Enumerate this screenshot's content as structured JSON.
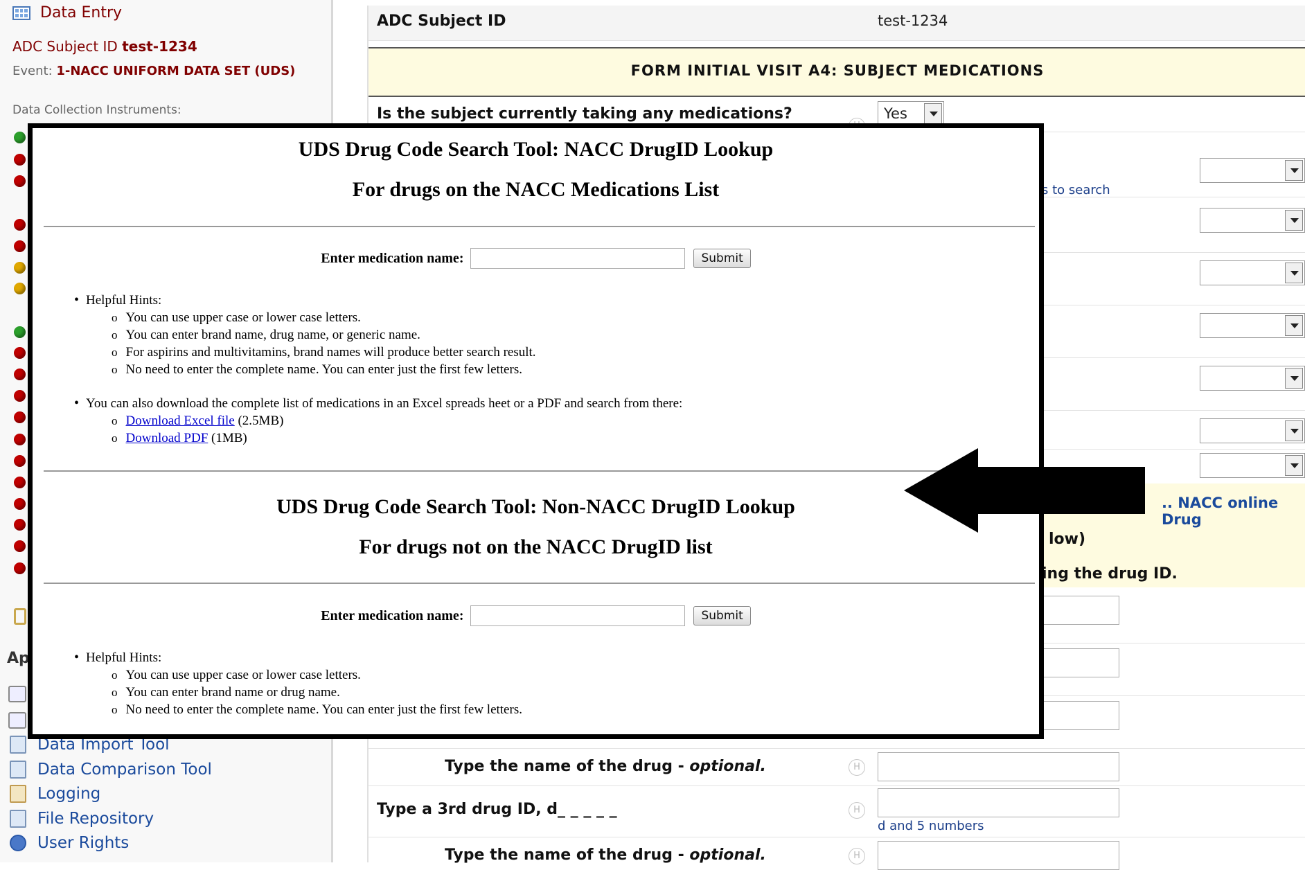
{
  "sidebar": {
    "menu_title": "Data Entry",
    "subject_label": "ADC Subject ID",
    "subject_id": "test-1234",
    "event_label": "Event:",
    "event_value": "1-NACC UNIFORM DATA SET (UDS)",
    "instruments_label": "Data Collection Instruments:",
    "status_dots": [
      "green",
      "red",
      "red",
      "red",
      "red",
      "yellow",
      "yellow",
      "green",
      "red",
      "red",
      "red",
      "red",
      "red",
      "red",
      "red",
      "red",
      "red",
      "red",
      "red"
    ],
    "apps_fragment": "Ap",
    "tools": [
      {
        "label": "Data Import Tool",
        "icon": "import-icon"
      },
      {
        "label": "Data Comparison Tool",
        "icon": "compare-icon"
      },
      {
        "label": "Logging",
        "icon": "logging-icon"
      },
      {
        "label": "File Repository",
        "icon": "file-repository-icon"
      },
      {
        "label": "User Rights",
        "icon": "user-rights-icon"
      }
    ]
  },
  "form": {
    "subject_label": "ADC Subject ID",
    "subject_value": "test-1234",
    "title": "FORM INITIAL VISIT A4: SUBJECT MEDICATIONS",
    "q_meds_label": "Is the subject currently taking any medications?",
    "q_meds_value": "Yes",
    "h_label": "H",
    "search_note_fragment": "s to search",
    "nacc_link_fragment": ".. NACC online Drug",
    "band_line2_fragment": "low)",
    "band_line3_fragment": "ing the drug ID.",
    "drug_name_label": "Type the name of the drug - ",
    "optional": "optional.",
    "third_drug_label": "Type a 3rd drug ID, d_ _ _ _ _",
    "third_drug_note": "d and 5 numbers"
  },
  "popup": {
    "nacc_title": "UDS Drug Code Search Tool: NACC DrugID Lookup",
    "nacc_subtitle": "For drugs on the NACC Medications List",
    "enter_label": "Enter medication name:",
    "submit_label": "Submit",
    "hints_label": "Helpful Hints:",
    "nacc_hints": [
      "You can use upper case or lower case letters.",
      "You can enter brand name, drug name, or generic name.",
      "For aspirins and multivitamins, brand names will produce better search result.",
      "No need to enter the complete name. You can enter just the first few letters."
    ],
    "download_text": "You can also download the complete list of medications in an Excel spreads heet or a PDF and search from there:",
    "download_excel": "Download Excel file",
    "download_excel_size": "(2.5MB)",
    "download_pdf": "Download PDF",
    "download_pdf_size": "(1MB)",
    "non_nacc_title": "UDS Drug Code Search Tool: Non-NACC DrugID Lookup",
    "non_nacc_subtitle": "For drugs not on the NACC DrugID list",
    "non_nacc_hints": [
      "You can use upper case or lower case letters.",
      "You can enter brand name or drug name.",
      "No need to enter the complete name. You can enter just the first few letters."
    ]
  },
  "colors": {
    "accent_red": "#800000",
    "link_blue": "#1a4a9c",
    "form_title_bg": "#fefbe0"
  }
}
